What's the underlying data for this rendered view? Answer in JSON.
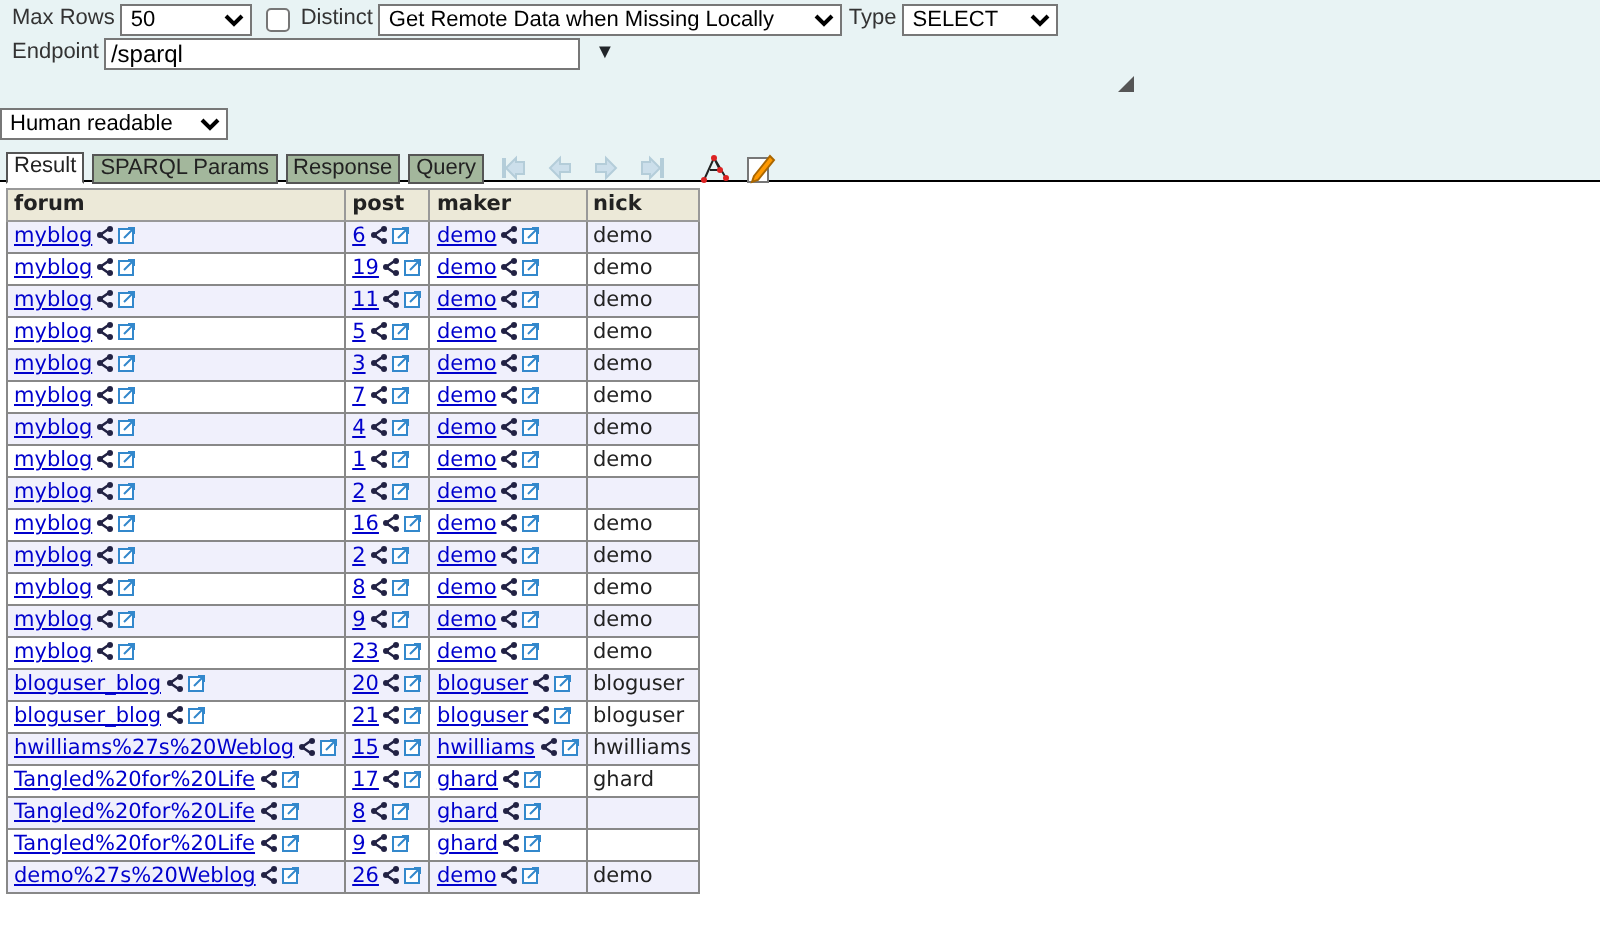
{
  "query_form": {
    "max_rows": {
      "label": "Max Rows",
      "value": "50"
    },
    "distinct": {
      "label": "Distinct",
      "checked": false
    },
    "remote_mode": {
      "value": "Get Remote Data when Missing Locally"
    },
    "type": {
      "label": "Type",
      "value": "SELECT"
    },
    "endpoint": {
      "label": "Endpoint",
      "value": "/sparql",
      "caret": "▼"
    }
  },
  "format": {
    "value": "Human readable"
  },
  "tabs": [
    {
      "label": "Result",
      "selected": true
    },
    {
      "label": "SPARQL Params",
      "selected": false
    },
    {
      "label": "Response",
      "selected": false
    },
    {
      "label": "Query",
      "selected": false
    }
  ],
  "toolbar": [
    {
      "kind": "first",
      "disabled": true
    },
    {
      "kind": "prev",
      "disabled": true
    },
    {
      "kind": "next",
      "disabled": true
    },
    {
      "kind": "last",
      "disabled": true
    },
    {
      "kind": "graph",
      "disabled": false
    },
    {
      "kind": "edit",
      "disabled": false
    }
  ],
  "table": {
    "columns": [
      "forum",
      "post",
      "maker",
      "nick"
    ],
    "rows": [
      {
        "forum": "myblog",
        "post": "6",
        "maker": "demo",
        "nick": "demo"
      },
      {
        "forum": "myblog",
        "post": "19",
        "maker": "demo",
        "nick": "demo"
      },
      {
        "forum": "myblog",
        "post": "11",
        "maker": "demo",
        "nick": "demo"
      },
      {
        "forum": "myblog",
        "post": "5",
        "maker": "demo",
        "nick": "demo"
      },
      {
        "forum": "myblog",
        "post": "3",
        "maker": "demo",
        "nick": "demo"
      },
      {
        "forum": "myblog",
        "post": "7",
        "maker": "demo",
        "nick": "demo"
      },
      {
        "forum": "myblog",
        "post": "4",
        "maker": "demo",
        "nick": "demo"
      },
      {
        "forum": "myblog",
        "post": "1",
        "maker": "demo",
        "nick": "demo"
      },
      {
        "forum": "myblog",
        "post": "2",
        "maker": "demo"
      },
      {
        "forum": "myblog",
        "post": "16",
        "maker": "demo",
        "nick": "demo"
      },
      {
        "forum": "myblog",
        "post": "2",
        "maker": "demo",
        "nick": "demo"
      },
      {
        "forum": "myblog",
        "post": "8",
        "maker": "demo",
        "nick": "demo"
      },
      {
        "forum": "myblog",
        "post": "9",
        "maker": "demo",
        "nick": "demo"
      },
      {
        "forum": "myblog",
        "post": "23",
        "maker": "demo",
        "nick": "demo"
      },
      {
        "forum": "bloguser_blog",
        "post": "20",
        "maker": "bloguser",
        "nick": "bloguser"
      },
      {
        "forum": "bloguser_blog",
        "post": "21",
        "maker": "bloguser",
        "nick": "bloguser"
      },
      {
        "forum": "hwilliams%27s%20Weblog",
        "post": "15",
        "maker": "hwilliams",
        "nick": "hwilliams"
      },
      {
        "forum": "Tangled%20for%20Life",
        "post": "17",
        "maker": "ghard",
        "nick": "ghard"
      },
      {
        "forum": "Tangled%20for%20Life",
        "post": "8",
        "maker": "ghard"
      },
      {
        "forum": "Tangled%20for%20Life",
        "post": "9",
        "maker": "ghard"
      },
      {
        "forum": "demo%27s%20Weblog",
        "post": "26",
        "maker": "demo",
        "nick": "demo"
      }
    ]
  }
}
